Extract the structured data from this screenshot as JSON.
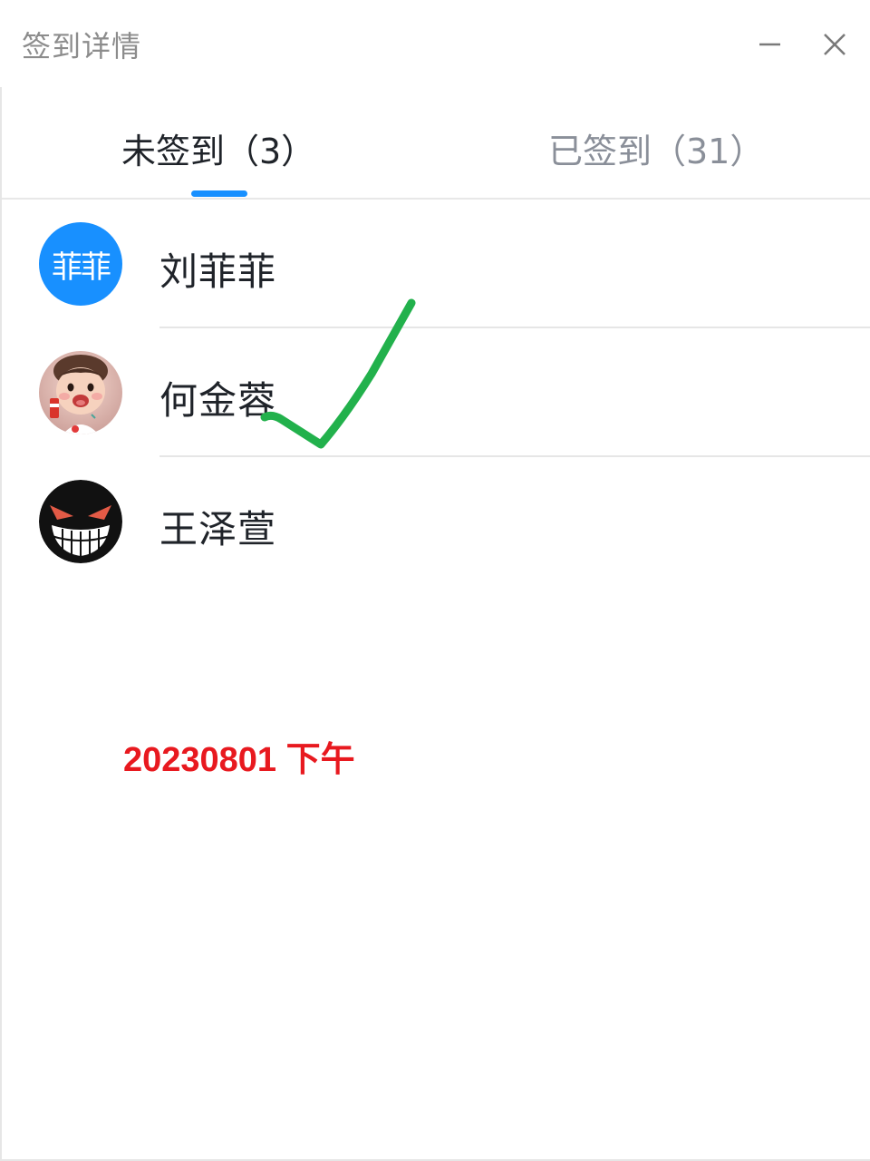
{
  "window": {
    "title": "签到详情",
    "minimize_icon": "minimize-icon",
    "close_icon": "close-icon"
  },
  "tabs": [
    {
      "label": "未签到（3）",
      "active": true
    },
    {
      "label": "已签到（31）",
      "active": false
    }
  ],
  "colors": {
    "accent": "#1890ff",
    "stamp": "#e8191f",
    "check": "#22b14c"
  },
  "members": [
    {
      "name": "刘菲菲",
      "avatar_text": "菲菲",
      "avatar_type": "text"
    },
    {
      "name": "何金蓉",
      "avatar_type": "photo",
      "avatar_icon": "child-photo-avatar"
    },
    {
      "name": "王泽萱",
      "avatar_type": "graphic",
      "avatar_icon": "grinning-face-avatar"
    }
  ],
  "annotation": {
    "stamp_text": "20230801 下午",
    "checkmark_icon": "handwritten-checkmark"
  }
}
